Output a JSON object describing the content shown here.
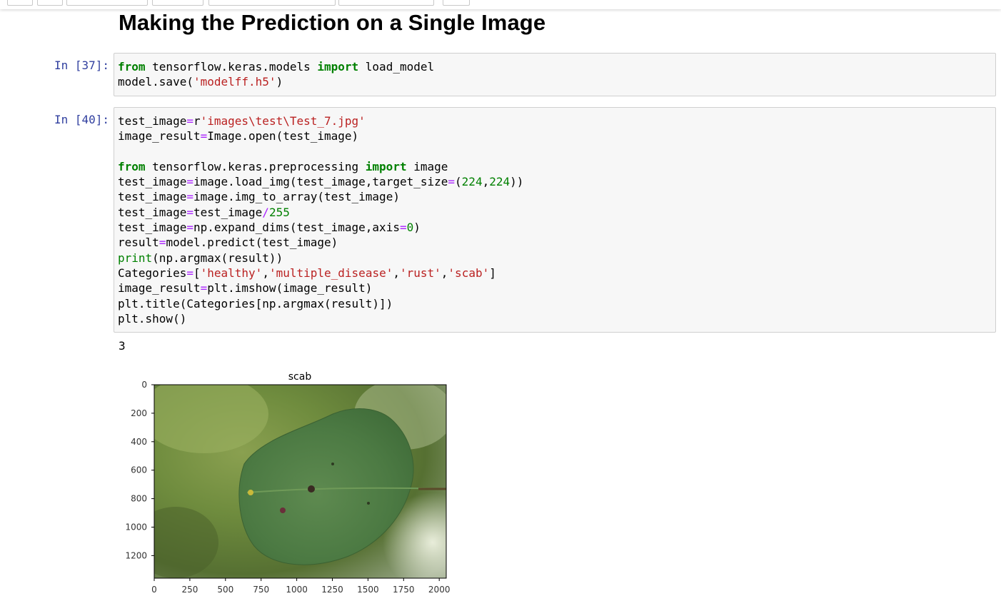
{
  "heading": "Making the Prediction on a Single Image",
  "cells": [
    {
      "prompt": "In [37]:",
      "lines": [
        [
          [
            "kw",
            "from"
          ],
          [
            "",
            " tensorflow.keras.models "
          ],
          [
            "kw",
            "import"
          ],
          [
            "",
            " load_model"
          ]
        ],
        [
          [
            "",
            "model.save("
          ],
          [
            "st",
            "'modelff.h5'"
          ],
          [
            "",
            ")"
          ]
        ]
      ]
    },
    {
      "prompt": "In [40]:",
      "lines": [
        [
          [
            "",
            "test_image"
          ],
          [
            "op",
            "="
          ],
          [
            "",
            "r"
          ],
          [
            "st",
            "'images\\test\\Test_7.jpg'"
          ]
        ],
        [
          [
            "",
            "image_result"
          ],
          [
            "op",
            "="
          ],
          [
            "",
            "Image.open(test_image)"
          ]
        ],
        [],
        [
          [
            "kw",
            "from"
          ],
          [
            "",
            " tensorflow.keras.preprocessing "
          ],
          [
            "kw",
            "import"
          ],
          [
            "",
            " image"
          ]
        ],
        [
          [
            "",
            "test_image"
          ],
          [
            "op",
            "="
          ],
          [
            "",
            "image.load_img(test_image,target_size"
          ],
          [
            "op",
            "="
          ],
          [
            "",
            "("
          ],
          [
            "nu",
            "224"
          ],
          [
            "",
            ","
          ],
          [
            "nu",
            "224"
          ],
          [
            "",
            "))"
          ]
        ],
        [
          [
            "",
            "test_image"
          ],
          [
            "op",
            "="
          ],
          [
            "",
            "image.img_to_array(test_image)"
          ]
        ],
        [
          [
            "",
            "test_image"
          ],
          [
            "op",
            "="
          ],
          [
            "",
            "test_image"
          ],
          [
            "op",
            "/"
          ],
          [
            "nu",
            "255"
          ]
        ],
        [
          [
            "",
            "test_image"
          ],
          [
            "op",
            "="
          ],
          [
            "",
            "np.expand_dims(test_image,axis"
          ],
          [
            "op",
            "="
          ],
          [
            "nu",
            "0"
          ],
          [
            "",
            ")"
          ]
        ],
        [
          [
            "",
            "result"
          ],
          [
            "op",
            "="
          ],
          [
            "",
            "model.predict(test_image)"
          ]
        ],
        [
          [
            "bi",
            "print"
          ],
          [
            "",
            "(np.argmax(result))"
          ]
        ],
        [
          [
            "",
            "Categories"
          ],
          [
            "op",
            "="
          ],
          [
            "",
            "["
          ],
          [
            "st",
            "'healthy'"
          ],
          [
            "",
            ","
          ],
          [
            "st",
            "'multiple_disease'"
          ],
          [
            "",
            ","
          ],
          [
            "st",
            "'rust'"
          ],
          [
            "",
            ","
          ],
          [
            "st",
            "'scab'"
          ],
          [
            "",
            "]"
          ]
        ],
        [
          [
            "",
            "image_result"
          ],
          [
            "op",
            "="
          ],
          [
            "",
            "plt.imshow(image_result)"
          ]
        ],
        [
          [
            "",
            "plt.title(Categories[np.argmax(result)])"
          ]
        ],
        [
          [
            "",
            "plt.show()"
          ]
        ]
      ]
    }
  ],
  "output": {
    "stdout": "3",
    "plot": {
      "title": "scab",
      "x_ticks": [
        "0",
        "250",
        "500",
        "750",
        "1000",
        "1250",
        "1500",
        "1750",
        "2000"
      ],
      "y_ticks": [
        "0",
        "200",
        "400",
        "600",
        "800",
        "1000",
        "1200"
      ],
      "colors": {
        "background_leaf": "#5a7a3a",
        "leaf": "#4e7d45",
        "frame": "#000000"
      }
    }
  }
}
